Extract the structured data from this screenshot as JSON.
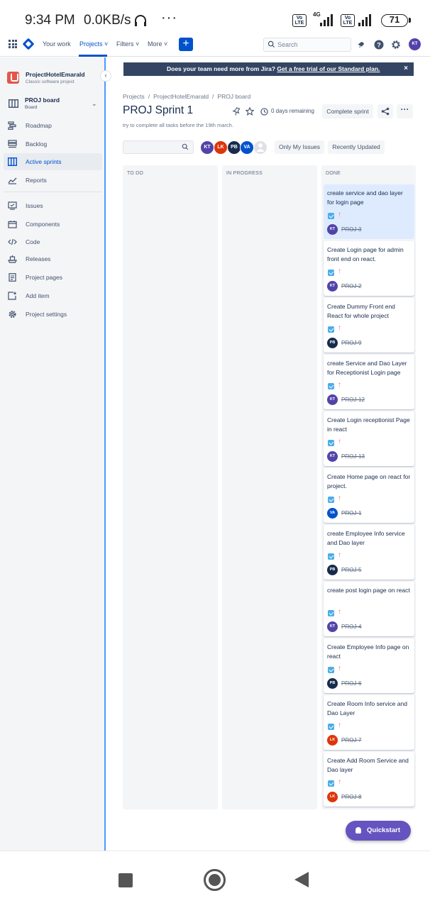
{
  "status_bar": {
    "time": "9:34 PM",
    "net_speed": "0.0KB/s",
    "network_type": "4G",
    "volte_label": "Vo LTE",
    "battery": "71"
  },
  "top_nav": {
    "items": [
      "Your work",
      "Projects",
      "Filters",
      "More"
    ],
    "active_item": "Projects",
    "create_label": "+",
    "search_placeholder": "Search",
    "user_initials": "KT"
  },
  "sidebar": {
    "project_name": "ProjectHotelEmarald",
    "project_type": "Classic software project",
    "board_name": "PROJ board",
    "board_sub": "Board",
    "items": [
      {
        "label": "Roadmap",
        "icon": "roadmap-icon"
      },
      {
        "label": "Backlog",
        "icon": "backlog-icon"
      },
      {
        "label": "Active sprints",
        "icon": "active-sprints-icon",
        "active": true
      },
      {
        "label": "Reports",
        "icon": "reports-icon"
      },
      {
        "label": "Issues",
        "icon": "issues-icon"
      },
      {
        "label": "Components",
        "icon": "components-icon"
      },
      {
        "label": "Code",
        "icon": "code-icon"
      },
      {
        "label": "Releases",
        "icon": "releases-icon"
      },
      {
        "label": "Project pages",
        "icon": "project-pages-icon"
      },
      {
        "label": "Add item",
        "icon": "add-item-icon"
      },
      {
        "label": "Project settings",
        "icon": "settings-icon"
      }
    ]
  },
  "banner": {
    "text": "Does your team need more from Jira?",
    "link": "Get a free trial of our Standard plan.",
    "close": "×"
  },
  "breadcrumbs": [
    "Projects",
    "ProjectHotelEmarald",
    "PROJ board"
  ],
  "breadcrumb_separator": "/",
  "sprint": {
    "title": "PROJ Sprint 1",
    "goal": "try to complete all tasks before the 19th march.",
    "days_remaining": "0 days remaining",
    "complete_label": "Complete sprint",
    "more_label": "···"
  },
  "filters": {
    "avatars": [
      {
        "initials": "KT",
        "color": "#5243aa"
      },
      {
        "initials": "LK",
        "color": "#de350b"
      },
      {
        "initials": "PB",
        "color": "#172b4d"
      },
      {
        "initials": "VA",
        "color": "#0052cc"
      }
    ],
    "only_my_issues": "Only My Issues",
    "recently_updated": "Recently Updated"
  },
  "columns": [
    {
      "name": "TO DO",
      "cards": []
    },
    {
      "name": "IN PROGRESS",
      "cards": []
    },
    {
      "name": "DONE",
      "cards": [
        {
          "title": "create service and dao layer for login page",
          "key": "PROJ-3",
          "assignee": "KT",
          "color": "#5243aa",
          "highlight": true
        },
        {
          "title": "Create Login page for admin front end on react.",
          "key": "PROJ-2",
          "assignee": "KT",
          "color": "#5243aa"
        },
        {
          "title": "Create Dummy Front end React for whole project",
          "key": "PROJ-9",
          "assignee": "PB",
          "color": "#172b4d"
        },
        {
          "title": "create Service and Dao Layer for Receptionist Login page",
          "key": "PROJ-12",
          "assignee": "KT",
          "color": "#5243aa"
        },
        {
          "title": "Create Login receptionist Page in react",
          "key": "PROJ-13",
          "assignee": "KT",
          "color": "#5243aa"
        },
        {
          "title": "Create Home page on react for project.",
          "key": "PROJ-1",
          "assignee": "VA",
          "color": "#0052cc"
        },
        {
          "title": "create Employee Info service and Dao layer",
          "key": "PROJ-5",
          "assignee": "PB",
          "color": "#172b4d"
        },
        {
          "title": "create post login page on react",
          "key": "PROJ-4",
          "assignee": "KT",
          "color": "#5243aa"
        },
        {
          "title": "Create Employee Info page on react",
          "key": "PROJ-6",
          "assignee": "PB",
          "color": "#172b4d"
        },
        {
          "title": "Create Room Info service and Dao Layer",
          "key": "PROJ-7",
          "assignee": "LK",
          "color": "#de350b"
        },
        {
          "title": "Create Add Room Service and Dao layer",
          "key": "PROJ-8",
          "assignee": "LK",
          "color": "#de350b"
        }
      ]
    }
  ],
  "quickstart_label": "Quickstart",
  "colors": {
    "brand": "#0052cc",
    "banner_bg": "#344563",
    "quickstart": "#6554c0",
    "priority": "#ff7452",
    "story": "#4bade8"
  }
}
